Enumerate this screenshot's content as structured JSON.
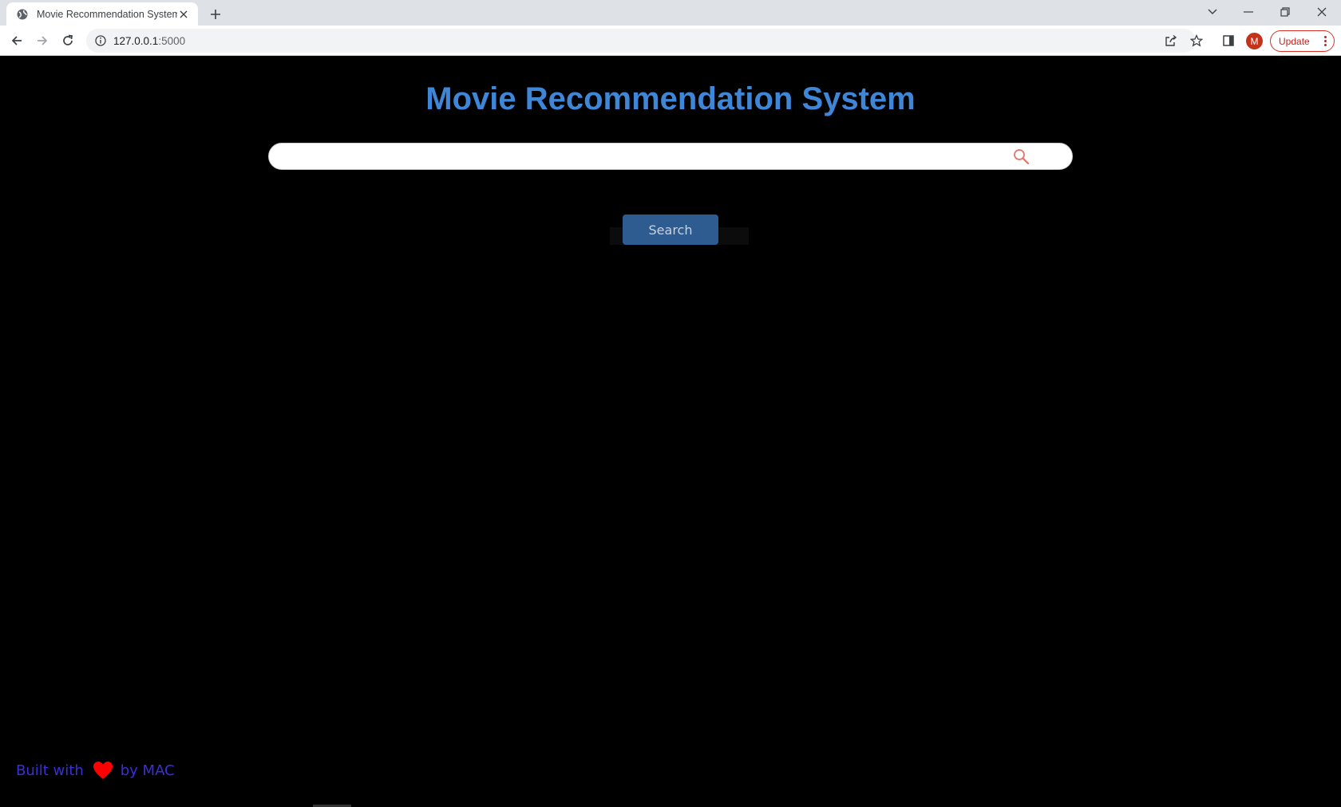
{
  "browser": {
    "tab_title": "Movie Recommendation System",
    "url_host": "127.0.0.1",
    "url_port": ":5000",
    "profile_initial": "M",
    "update_label": "Update"
  },
  "page": {
    "title": "Movie Recommendation System",
    "search": {
      "value": "",
      "placeholder": ""
    },
    "search_button_label": "Search",
    "footer": {
      "prefix": "Built with",
      "suffix": "by MAC"
    }
  },
  "colors": {
    "title": "#3f87d6",
    "background": "#000000",
    "search_button": "#2e5b90",
    "footer_text": "#3b2fd6",
    "heart": "#ff0000",
    "search_icon": "#e8736b"
  },
  "icons": {
    "favicon": "globe-icon",
    "search": "magnifier-icon",
    "heart": "heart-icon"
  }
}
